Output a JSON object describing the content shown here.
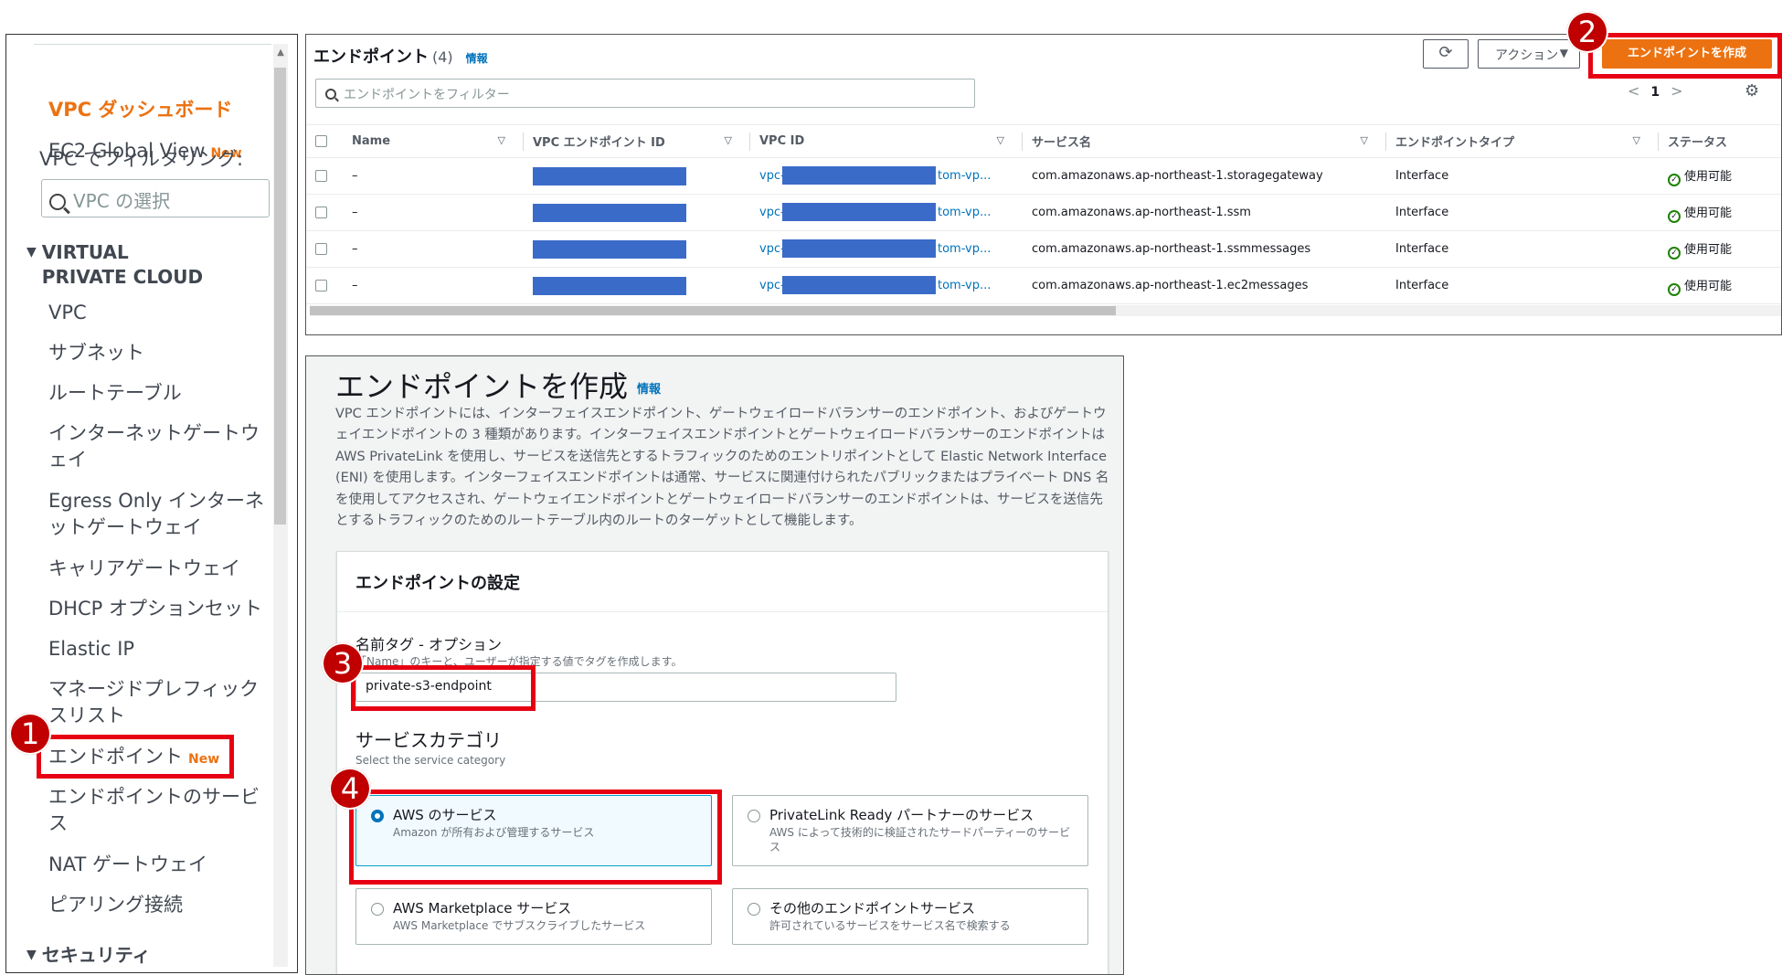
{
  "sidebar": {
    "dashboard": "VPC ダッシュボード",
    "ec2_global_view": "EC2 Global View",
    "new_badge": "New",
    "filter_label": "VPC でフィルタリング:",
    "filter_placeholder": "VPC の選択",
    "section_vpc": "VIRTUAL PRIVATE CLOUD",
    "items": [
      "VPC",
      "サブネット",
      "ルートテーブル",
      "インターネットゲートウェイ",
      "Egress Only インターネットゲートウェイ",
      "キャリアゲートウェイ",
      "DHCP オプションセット",
      "Elastic IP",
      "マネージドプレフィックスリスト",
      "エンドポイント",
      "エンドポイントのサービス",
      "NAT ゲートウェイ",
      "ピアリング接続"
    ],
    "section_security": "セキュリティ"
  },
  "endpoints": {
    "title": "エンドポイント",
    "count": "(4)",
    "info": "情報",
    "filter_placeholder": "エンドポイントをフィルター",
    "actions_label": "アクション",
    "create_label": "エンドポイントを作成",
    "page": "1",
    "columns": [
      "Name",
      "VPC エンドポイント ID",
      "VPC ID",
      "サービス名",
      "エンドポイントタイプ",
      "ステータス"
    ],
    "rows": [
      {
        "name": "–",
        "vpc_prefix": "vpc-",
        "vpc_suffix": "tom-vp...",
        "service": "com.amazonaws.ap-northeast-1.storagegateway",
        "type": "Interface",
        "status": "使用可能"
      },
      {
        "name": "–",
        "vpc_prefix": "vpc-",
        "vpc_suffix": "tom-vp...",
        "service": "com.amazonaws.ap-northeast-1.ssm",
        "type": "Interface",
        "status": "使用可能"
      },
      {
        "name": "–",
        "vpc_prefix": "vpc-",
        "vpc_suffix": "tom-vp...",
        "service": "com.amazonaws.ap-northeast-1.ssmmessages",
        "type": "Interface",
        "status": "使用可能"
      },
      {
        "name": "–",
        "vpc_prefix": "vpc-",
        "vpc_suffix": "tom-vp...",
        "service": "com.amazonaws.ap-northeast-1.ec2messages",
        "type": "Interface",
        "status": "使用可能"
      }
    ]
  },
  "create": {
    "heading": "エンドポイントを作成",
    "info": "情報",
    "description": "VPC エンドポイントには、インターフェイスエンドポイント、ゲートウェイロードバランサーのエンドポイント、およびゲートウェイエンドポイントの 3 種類があります。インターフェイスエンドポイントとゲートウェイロードバランサーのエンドポイントは AWS PrivateLink を使用し、サービスを送信先とするトラフィックのためのエントリポイントとして Elastic Network Interface (ENI) を使用します。インターフェイスエンドポイントは通常、サービスに関連付けられたパブリックまたはプライベート DNS 名を使用してアクセスされ、ゲートウェイエンドポイントとゲートウェイロードバランサーのエンドポイントは、サービスを送信先とするトラフィックのためのルートテーブル内のルートのターゲットとして機能します。",
    "settings_title": "エンドポイントの設定",
    "name_label": "名前タグ - オプション",
    "name_hint": "「Name」のキーと、ユーザーが指定する値でタグを作成します。",
    "name_value": "private-s3-endpoint",
    "category_label": "サービスカテゴリ",
    "category_hint": "Select the service category",
    "tiles": [
      {
        "title": "AWS のサービス",
        "desc": "Amazon が所有および管理するサービス"
      },
      {
        "title": "PrivateLink Ready パートナーのサービス",
        "desc": "AWS によって技術的に検証されたサードパーティーのサービス"
      },
      {
        "title": "AWS Marketplace サービス",
        "desc": "AWS Marketplace でサブスクライブしたサービス"
      },
      {
        "title": "その他のエンドポイントサービス",
        "desc": "許可されているサービスをサービス名で検索する"
      }
    ]
  },
  "annotations": {
    "step1": "1",
    "step2": "2",
    "step3": "3",
    "step4": "4",
    "color": "#e60012"
  },
  "colors": {
    "accent": "#ec7211",
    "link": "#0073bb",
    "success": "#1d8102"
  }
}
